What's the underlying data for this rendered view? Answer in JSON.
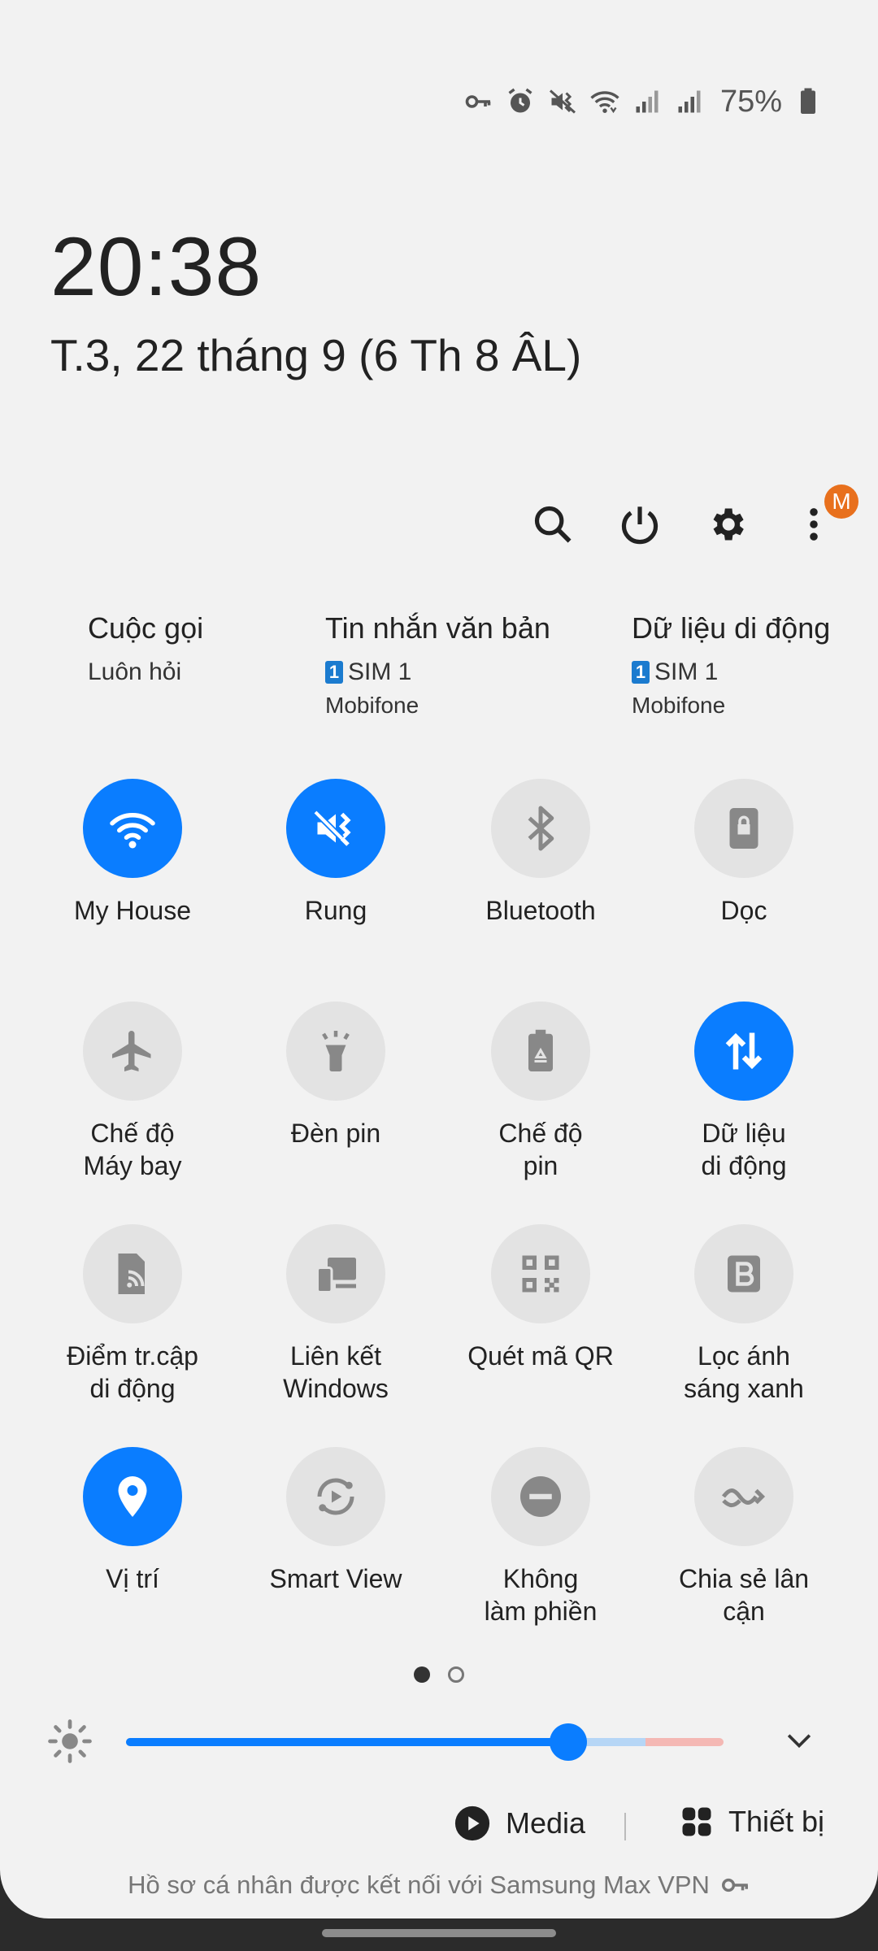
{
  "status_bar": {
    "icons": [
      "vpn-key-icon",
      "alarm-icon",
      "vibrate-icon",
      "wifi-icon",
      "signal-sim1-icon",
      "signal-sim2-icon",
      "battery-icon"
    ],
    "battery_percent": "75%"
  },
  "clock": {
    "time": "20:38",
    "date": "T.3, 22 tháng 9 (6 Th 8 ÂL)"
  },
  "header_actions": {
    "icons": [
      "search-icon",
      "power-icon",
      "gear-icon",
      "more-icon"
    ],
    "badge": "M",
    "badge_color": "#e8701d"
  },
  "sim_info": [
    {
      "title": "Cuộc gọi",
      "line": "Luôn hỏi"
    },
    {
      "title": "Tin nhắn văn bản",
      "sim_num": "1",
      "sim": "SIM 1",
      "carrier": "Mobifone"
    },
    {
      "title": "Dữ liệu di động",
      "sim_num": "1",
      "sim": "SIM 1",
      "carrier": "Mobifone"
    }
  ],
  "tiles": [
    {
      "label": "My House",
      "icon": "wifi-icon",
      "on": true
    },
    {
      "label": "Rung",
      "icon": "vibrate-icon",
      "on": true
    },
    {
      "label": "Bluetooth",
      "icon": "bluetooth-icon",
      "on": false
    },
    {
      "label": "Dọc",
      "icon": "rotation-lock-icon",
      "on": false
    },
    {
      "label": "Chế độ\nMáy bay",
      "icon": "airplane-icon",
      "on": false
    },
    {
      "label": "Đèn pin",
      "icon": "flashlight-icon",
      "on": false
    },
    {
      "label": "Chế độ\npin",
      "icon": "power-saving-icon",
      "on": false
    },
    {
      "label": "Dữ liệu\ndi động",
      "icon": "mobile-data-icon",
      "on": true
    },
    {
      "label": "Điểm tr.cập\ndi động",
      "icon": "hotspot-icon",
      "on": false
    },
    {
      "label": "Liên kết\nWindows",
      "icon": "link-windows-icon",
      "on": false
    },
    {
      "label": "Quét mã QR",
      "icon": "qr-code-icon",
      "on": false
    },
    {
      "label": "Lọc ánh\nsáng xanh",
      "icon": "blue-light-filter-icon",
      "on": false
    },
    {
      "label": "Vị trí",
      "icon": "location-icon",
      "on": true
    },
    {
      "label": "Smart View",
      "icon": "smart-view-icon",
      "on": false
    },
    {
      "label": "Không\nlàm phiền",
      "icon": "do-not-disturb-icon",
      "on": false
    },
    {
      "label": "Chia sẻ lân\ncận",
      "icon": "nearby-share-icon",
      "on": false
    }
  ],
  "pagination": {
    "current": 1,
    "total": 2
  },
  "brightness": {
    "value": 0.74,
    "comfort_start": 0.87
  },
  "bottom_actions": {
    "media": "Media",
    "devices": "Thiết bị"
  },
  "vpn_note": "Hồ sơ cá nhân được kết nối với Samsung Max VPN",
  "colors": {
    "accent": "#0a7dff",
    "tile_off": "#e3e3e3",
    "panel_bg": "#f2f2f2"
  }
}
